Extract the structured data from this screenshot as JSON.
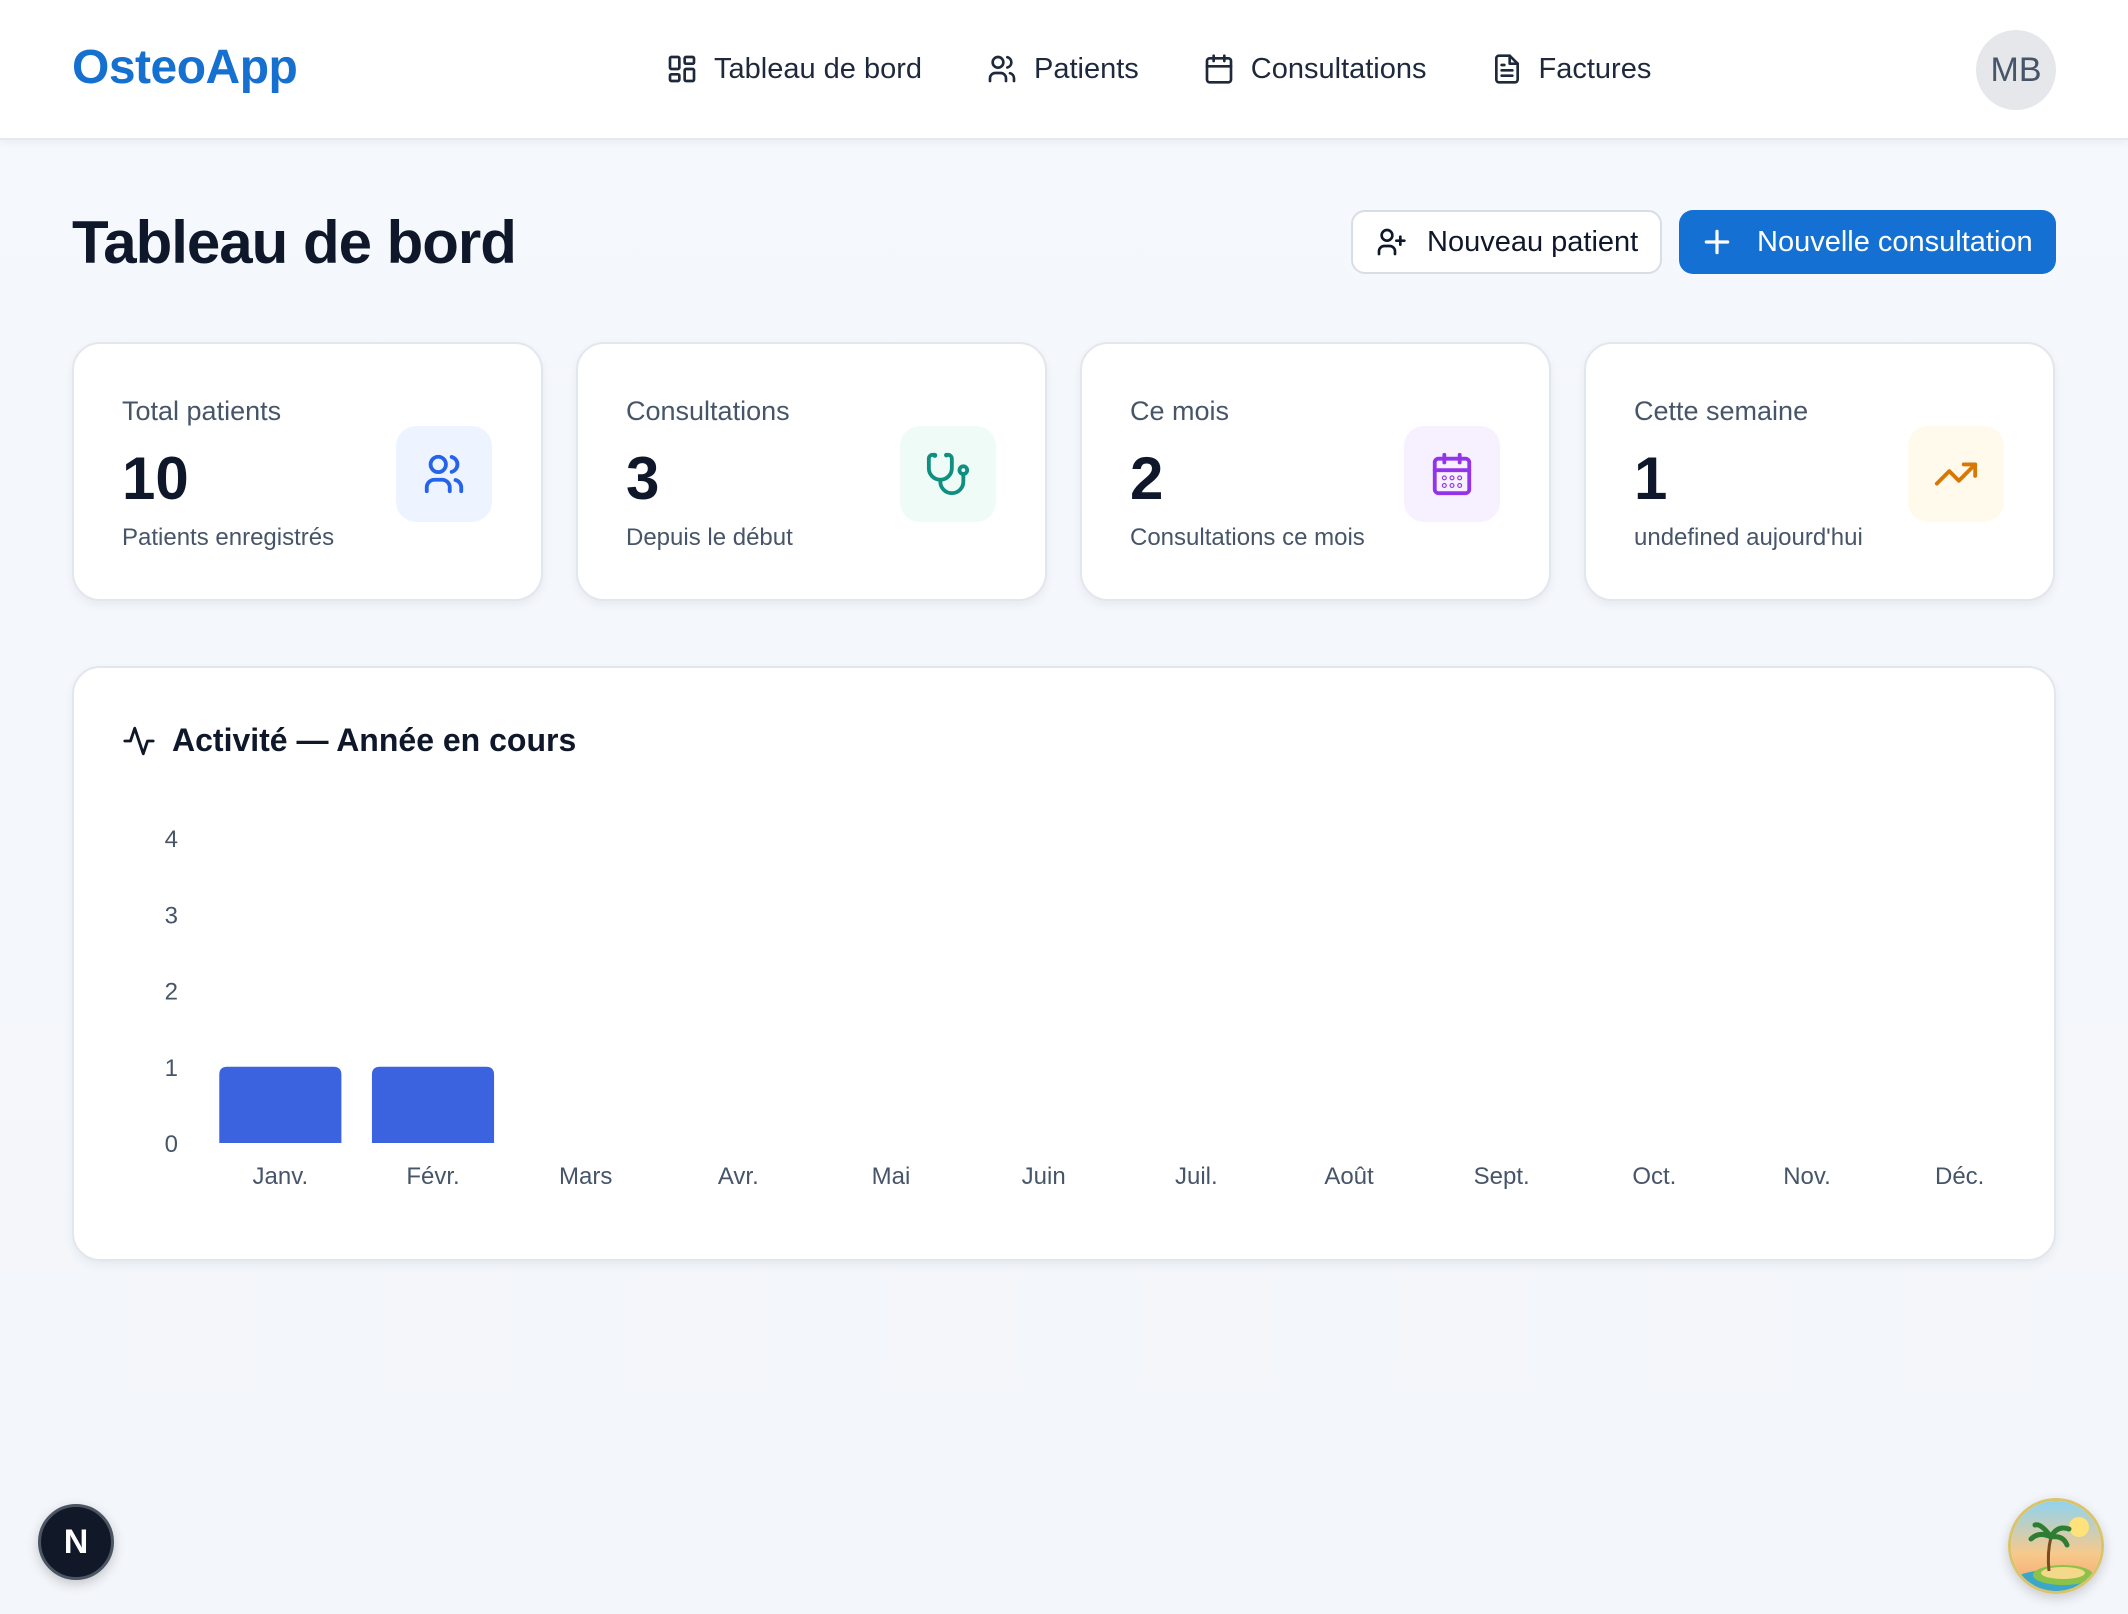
{
  "header": {
    "logo": "OsteoApp",
    "nav": [
      {
        "label": "Tableau de bord",
        "icon": "dashboard-grid-icon"
      },
      {
        "label": "Patients",
        "icon": "users-icon"
      },
      {
        "label": "Consultations",
        "icon": "calendar-icon"
      },
      {
        "label": "Factures",
        "icon": "document-icon"
      }
    ],
    "avatar_initials": "MB"
  },
  "page": {
    "title": "Tableau de bord",
    "new_patient_label": "Nouveau patient",
    "new_consultation_label": "Nouvelle consultation"
  },
  "stats": [
    {
      "label": "Total patients",
      "value": "10",
      "sub": "Patients enregistrés",
      "icon": "users-icon",
      "color": "#2563eb",
      "bg": "#eef4ff"
    },
    {
      "label": "Consultations",
      "value": "3",
      "sub": "Depuis le début",
      "icon": "stethoscope-icon",
      "color": "#0f8f7f",
      "bg": "#effbf7"
    },
    {
      "label": "Ce mois",
      "value": "2",
      "sub": "Consultations ce mois",
      "icon": "calendar-days-icon",
      "color": "#9333ea",
      "bg": "#f7f0ff"
    },
    {
      "label": "Cette semaine",
      "value": "1",
      "sub": "undefined aujourd'hui",
      "icon": "trending-up-icon",
      "color": "#d97706",
      "bg": "#fffaeb"
    }
  ],
  "activity": {
    "title": "Activité — Année en cours",
    "icon": "activity-icon"
  },
  "chart_data": {
    "type": "bar",
    "title": "Activité — Année en cours",
    "categories": [
      "Janv.",
      "Févr.",
      "Mars",
      "Avr.",
      "Mai",
      "Juin",
      "Juil.",
      "Août",
      "Sept.",
      "Oct.",
      "Nov.",
      "Déc."
    ],
    "values": [
      1,
      1,
      0,
      0,
      0,
      0,
      0,
      0,
      0,
      0,
      0,
      0
    ],
    "yticks": [
      0,
      1,
      2,
      3,
      4
    ],
    "ylim": [
      0,
      4
    ],
    "xlabel": "",
    "ylabel": "",
    "grid": false,
    "bar_color": "#3b63e0"
  },
  "floating": {
    "dev_badge": "N",
    "corner_icon": "beach-island-icon"
  }
}
